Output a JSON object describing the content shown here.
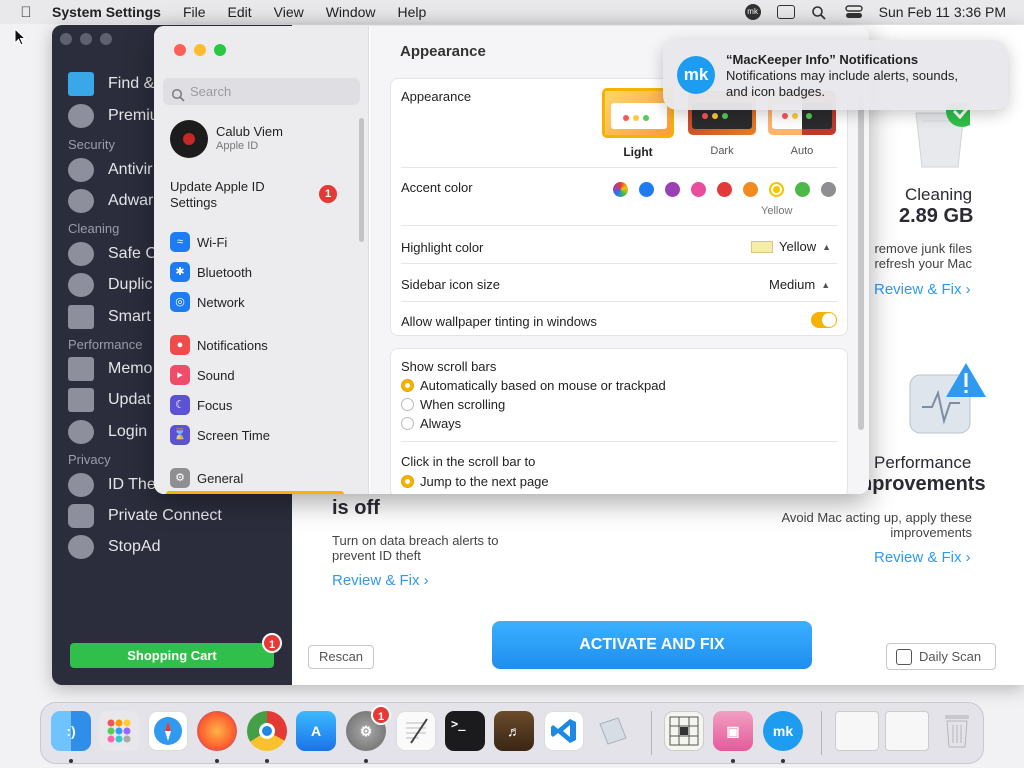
{
  "menubar": {
    "apple_icon": "apple-icon",
    "app_name": "System Settings",
    "menus": [
      "File",
      "Edit",
      "View",
      "Window",
      "Help"
    ],
    "clock": "Sun Feb 11  3:36 PM"
  },
  "mackeeper": {
    "sidebar": {
      "sections": {
        "security": "Security",
        "cleaning": "Cleaning",
        "performance": "Performance",
        "privacy": "Privacy"
      },
      "items": {
        "find": "Find &",
        "premium": "Premiu",
        "antivirus": "Antivir",
        "adware": "Adwar",
        "safe_cleanup": "Safe C",
        "duplicates": "Duplic",
        "smart_uninstaller": "Smart",
        "memory": "Memo",
        "update": "Updat",
        "login": "Login",
        "id_theft": "ID The",
        "private_connect": "Private Connect",
        "stopad": "StopAd"
      },
      "shopping_cart": "Shopping Cart",
      "cart_badge": "1"
    },
    "idtheft_card": {
      "title": "is off",
      "desc_line1": "Turn on data breach alerts to",
      "desc_line2": "prevent ID theft",
      "link": "Review & Fix ›"
    },
    "cleaning_card": {
      "title": "Cleaning",
      "size": "2.89 GB",
      "desc_line1": "remove junk files",
      "desc_line2": "refresh your Mac",
      "link": "Review & Fix ›"
    },
    "performance_card": {
      "title_line1": "Performance",
      "title_line2": "nprovements",
      "desc_line1": "Avoid Mac acting up, apply these",
      "desc_line2": "improvements",
      "link": "Review & Fix ›"
    },
    "rescan": "Rescan",
    "activate": "ACTIVATE AND FIX",
    "daily_scan": "Daily Scan"
  },
  "system_settings": {
    "search_placeholder": "Search",
    "user_name": "Calub Viem",
    "user_sub": "Apple ID",
    "update_line1": "Update Apple ID",
    "update_line2": "Settings",
    "update_badge": "1",
    "sidebar_items": {
      "wifi": "Wi-Fi",
      "bluetooth": "Bluetooth",
      "network": "Network",
      "notifications": "Notifications",
      "sound": "Sound",
      "focus": "Focus",
      "screen_time": "Screen Time",
      "general": "General"
    },
    "page_title": "Appearance",
    "appearance_label": "Appearance",
    "appearance_options": [
      "Light",
      "Dark",
      "Auto"
    ],
    "appearance_selected": "Light",
    "accent_label": "Accent color",
    "accent_selected_name": "Yellow",
    "accent_colors": [
      "multicolor",
      "#1e7cf2",
      "#9b3fb5",
      "#e94d9c",
      "#e5383b",
      "#f38a1f",
      "#f5c400",
      "#4cb84a",
      "#8e8e93"
    ],
    "highlight_label": "Highlight color",
    "highlight_value": "Yellow",
    "highlight_swatch": "#f7ecb0",
    "sidebar_icon_label": "Sidebar icon size",
    "sidebar_icon_value": "Medium",
    "tinting_label": "Allow wallpaper tinting in windows",
    "tinting_on": true,
    "scrollbars_label": "Show scroll bars",
    "scrollbar_options": [
      "Automatically based on mouse or trackpad",
      "When scrolling",
      "Always"
    ],
    "scrollbar_selected": 0,
    "click_label": "Click in the scroll bar to",
    "click_options": [
      "Jump to the next page"
    ]
  },
  "notification": {
    "title": "“MacKeeper Info” Notifications",
    "body_line1": "Notifications may include alerts, sounds,",
    "body_line2": "and icon badges.",
    "logo": "mk"
  },
  "dock": {
    "apps": [
      "Finder",
      "Launchpad",
      "Safari",
      "Firefox",
      "Chrome",
      "App Store",
      "System Settings",
      "TextEdit",
      "Terminal",
      "Instruments",
      "VS Code",
      "Preview",
      "Vectorize",
      "CleanMyMac",
      "MacKeeper"
    ],
    "settings_badge": "1"
  }
}
